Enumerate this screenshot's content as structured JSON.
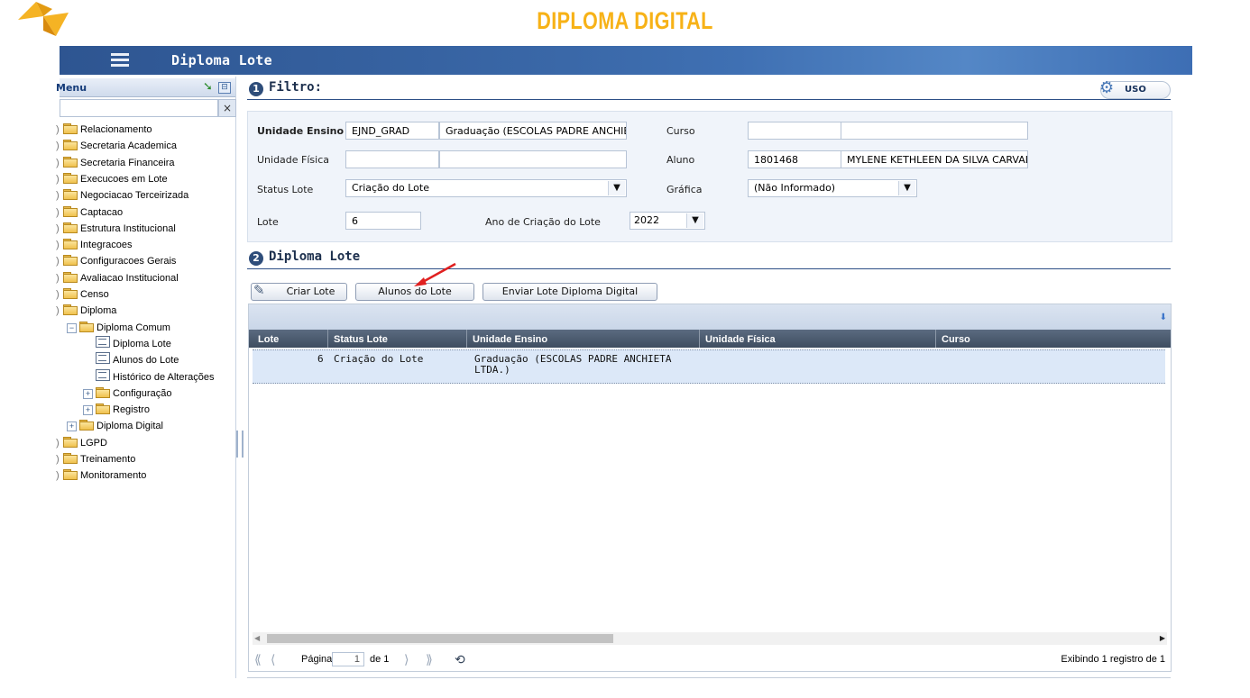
{
  "brand": {
    "title": "DIPLOMA DIGITAL"
  },
  "titlebar": {
    "title": "Diploma Lote"
  },
  "sidebar": {
    "header": "Menu",
    "search_value": "",
    "items": [
      {
        "label": "Relacionamento",
        "type": "folder",
        "level": 0
      },
      {
        "label": "Secretaria Academica",
        "type": "folder",
        "level": 0
      },
      {
        "label": "Secretaria Financeira",
        "type": "folder",
        "level": 0
      },
      {
        "label": "Execucoes em Lote",
        "type": "folder",
        "level": 0
      },
      {
        "label": "Negociacao Terceirizada",
        "type": "folder",
        "level": 0
      },
      {
        "label": "Captacao",
        "type": "folder",
        "level": 0
      },
      {
        "label": "Estrutura Institucional",
        "type": "folder",
        "level": 0
      },
      {
        "label": "Integracoes",
        "type": "folder",
        "level": 0
      },
      {
        "label": "Configuracoes Gerais",
        "type": "folder",
        "level": 0
      },
      {
        "label": "Avaliacao Institucional",
        "type": "folder",
        "level": 0
      },
      {
        "label": "Censo",
        "type": "folder",
        "level": 0
      },
      {
        "label": "Diploma",
        "type": "folder-open",
        "level": 0
      },
      {
        "label": "Diploma Comum",
        "type": "folder-open",
        "level": 1,
        "expander": "⊟"
      },
      {
        "label": "Diploma Lote",
        "type": "doc",
        "level": 2
      },
      {
        "label": "Alunos do Lote",
        "type": "doc",
        "level": 2
      },
      {
        "label": "Histórico de Alterações",
        "type": "doc",
        "level": 2
      },
      {
        "label": "Configuração",
        "type": "folder",
        "level": 2,
        "expander": "⊞"
      },
      {
        "label": "Registro",
        "type": "folder",
        "level": 2,
        "expander": "⊞"
      },
      {
        "label": "Diploma Digital",
        "type": "folder",
        "level": 1,
        "expander": "⊞"
      },
      {
        "label": "LGPD",
        "type": "folder",
        "level": 0
      },
      {
        "label": "Treinamento",
        "type": "folder",
        "level": 0
      },
      {
        "label": "Monitoramento",
        "type": "folder",
        "level": 0
      }
    ]
  },
  "filter": {
    "num": "1",
    "title": "Filtro:",
    "uso_label": "USO",
    "unidade_ensino_label": "Unidade Ensino",
    "unidade_ensino_code": "EJND_GRAD",
    "unidade_ensino_name": "Graduação (ESCOLAS PADRE ANCHIETA",
    "curso_label": "Curso",
    "curso_code": "",
    "curso_name": "",
    "unidade_fisica_label": "Unidade Física",
    "unidade_fisica_code": "",
    "unidade_fisica_name": "",
    "aluno_label": "Aluno",
    "aluno_code": "1801468",
    "aluno_name": "MYLENE KETHLEEN DA SILVA CARVALH",
    "status_lote_label": "Status Lote",
    "status_lote_value": "Criação do Lote",
    "grafica_label": "Gráfica",
    "grafica_value": "(Não Informado)",
    "lote_label": "Lote",
    "lote_value": "6",
    "ano_label": "Ano de Criação do Lote",
    "ano_value": "2022"
  },
  "lote_section": {
    "num": "2",
    "title": "Diploma Lote",
    "buttons": {
      "criar": "Criar Lote",
      "alunos": "Alunos do Lote",
      "enviar": "Enviar Lote Diploma Digital"
    }
  },
  "grid": {
    "columns": [
      "Lote",
      "Status Lote",
      "Unidade Ensino",
      "Unidade Física",
      "Curso"
    ],
    "rows": [
      {
        "lote": "6",
        "status": "Criação do Lote",
        "unidade_ensino": "Graduação (ESCOLAS PADRE ANCHIETA",
        "unidade_ensino_2": "LTDA.)",
        "unidade_fisica": "",
        "curso": ""
      }
    ]
  },
  "pager": {
    "page_label": "Página",
    "page_value": "1",
    "of_label": "de 1",
    "status": "Exibindo 1 registro de 1"
  }
}
